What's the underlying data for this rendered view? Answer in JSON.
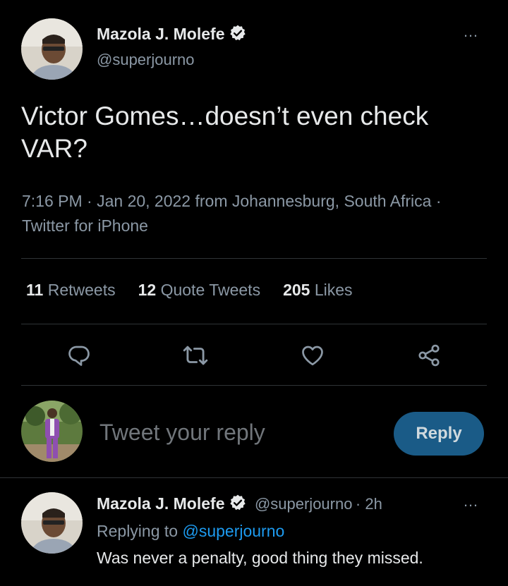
{
  "tweet": {
    "author_name": "Mazola J. Molefe",
    "author_handle": "@superjourno",
    "text": "Victor Gomes…doesn’t even check VAR?",
    "meta": "7:16 PM · Jan 20, 2022 from Johannesburg, South Africa · Twitter for iPhone",
    "more_icon": "…",
    "stats": {
      "retweets_count": "11",
      "retweets_label": "Retweets",
      "quotes_count": "12",
      "quotes_label": "Quote Tweets",
      "likes_count": "205",
      "likes_label": "Likes"
    }
  },
  "compose": {
    "placeholder": "Tweet your reply",
    "button_label": "Reply"
  },
  "reply": {
    "author_name": "Mazola J. Molefe",
    "author_handle": "@superjourno",
    "time": "· 2h",
    "replying_prefix": "Replying to",
    "replying_to": "@superjourno",
    "text": "Was never a penalty, good thing they missed."
  },
  "colors": {
    "background": "#000000",
    "text": "#e7e9ea",
    "muted": "#8b98a5",
    "link": "#1d9bf0",
    "reply_button": "#1a5b87"
  },
  "icons": [
    "verified-badge-icon",
    "more-icon",
    "reply-icon",
    "retweet-icon",
    "like-icon",
    "share-icon"
  ]
}
